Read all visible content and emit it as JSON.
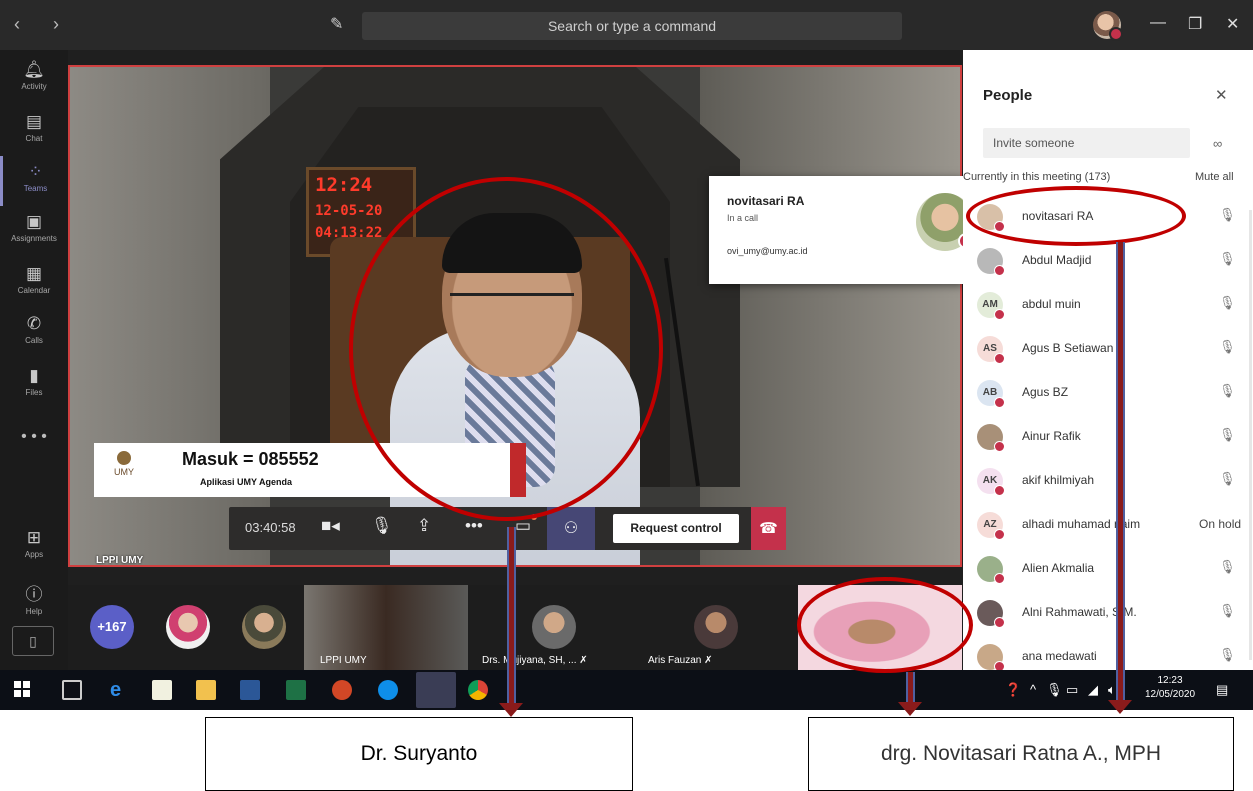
{
  "titlebar": {
    "search_placeholder": "Search or type a command"
  },
  "rail": {
    "items": [
      {
        "label": "Activity",
        "icon": "bell-icon"
      },
      {
        "label": "Chat",
        "icon": "chat-icon"
      },
      {
        "label": "Teams",
        "icon": "teams-icon"
      },
      {
        "label": "Assignments",
        "icon": "assignments-icon"
      },
      {
        "label": "Calendar",
        "icon": "calendar-icon"
      },
      {
        "label": "Calls",
        "icon": "phone-icon"
      },
      {
        "label": "Files",
        "icon": "file-icon"
      }
    ],
    "more": "• • •",
    "bottom": [
      {
        "label": "Apps",
        "icon": "apps-icon"
      },
      {
        "label": "Help",
        "icon": "help-icon"
      }
    ]
  },
  "stage": {
    "clock_time": "12:24",
    "clock_date": "12-05-20",
    "clock_extra": "04:13:22",
    "lower_third_logo": "UMY",
    "lower_third_title": "Masuk = 085552",
    "lower_third_sub": "Aplikasi UMY Agenda",
    "speaker_name": "LPPI UMY"
  },
  "controls": {
    "timer": "03:40:58",
    "request_control": "Request control"
  },
  "gallery": {
    "more_count": "+167",
    "tiles": [
      {
        "name": "LPPI UMY"
      },
      {
        "name": "Drs. Mujiyana, SH, ..."
      },
      {
        "name": "Aris Fauzan"
      }
    ]
  },
  "popover": {
    "name": "novitasari RA",
    "status": "In a call",
    "email": "ovi_umy@umy.ac.id"
  },
  "panel": {
    "title": "People",
    "invite_placeholder": "Invite someone",
    "current_header": "Currently in this meeting (173)",
    "mute_all": "Mute all",
    "people": [
      {
        "name": "novitasari RA",
        "initials": "",
        "color": "#d8c0a8",
        "status": "muted"
      },
      {
        "name": "Abdul Madjid",
        "initials": "",
        "color": "#b8b8b8",
        "status": "muted"
      },
      {
        "name": "abdul muin",
        "initials": "AM",
        "color": "#e3ecd9",
        "status": "muted"
      },
      {
        "name": "Agus B Setiawan",
        "initials": "AS",
        "color": "#f6dcd8",
        "status": "muted"
      },
      {
        "name": "Agus BZ",
        "initials": "AB",
        "color": "#dbe5f1",
        "status": "muted"
      },
      {
        "name": "Ainur Rafik",
        "initials": "",
        "color": "#a89078",
        "status": "muted"
      },
      {
        "name": "akif khilmiyah",
        "initials": "AK",
        "color": "#f4e0ef",
        "status": "muted"
      },
      {
        "name": "alhadi muhamad naim",
        "initials": "AZ",
        "color": "#f6dcd8",
        "status": "On hold"
      },
      {
        "name": "Alien Akmalia",
        "initials": "",
        "color": "#9ab08a",
        "status": "muted"
      },
      {
        "name": "Alni Rahmawati, S.M.",
        "initials": "",
        "color": "#6a5a5a",
        "status": "muted"
      },
      {
        "name": "ana medawati",
        "initials": "",
        "color": "#c8a888",
        "status": "muted"
      }
    ]
  },
  "taskbar": {
    "time": "12:23",
    "date": "12/05/2020"
  },
  "annotations": {
    "left_label": "Dr. Suryanto",
    "right_label": "drg. Novitasari Ratna A., MPH"
  }
}
